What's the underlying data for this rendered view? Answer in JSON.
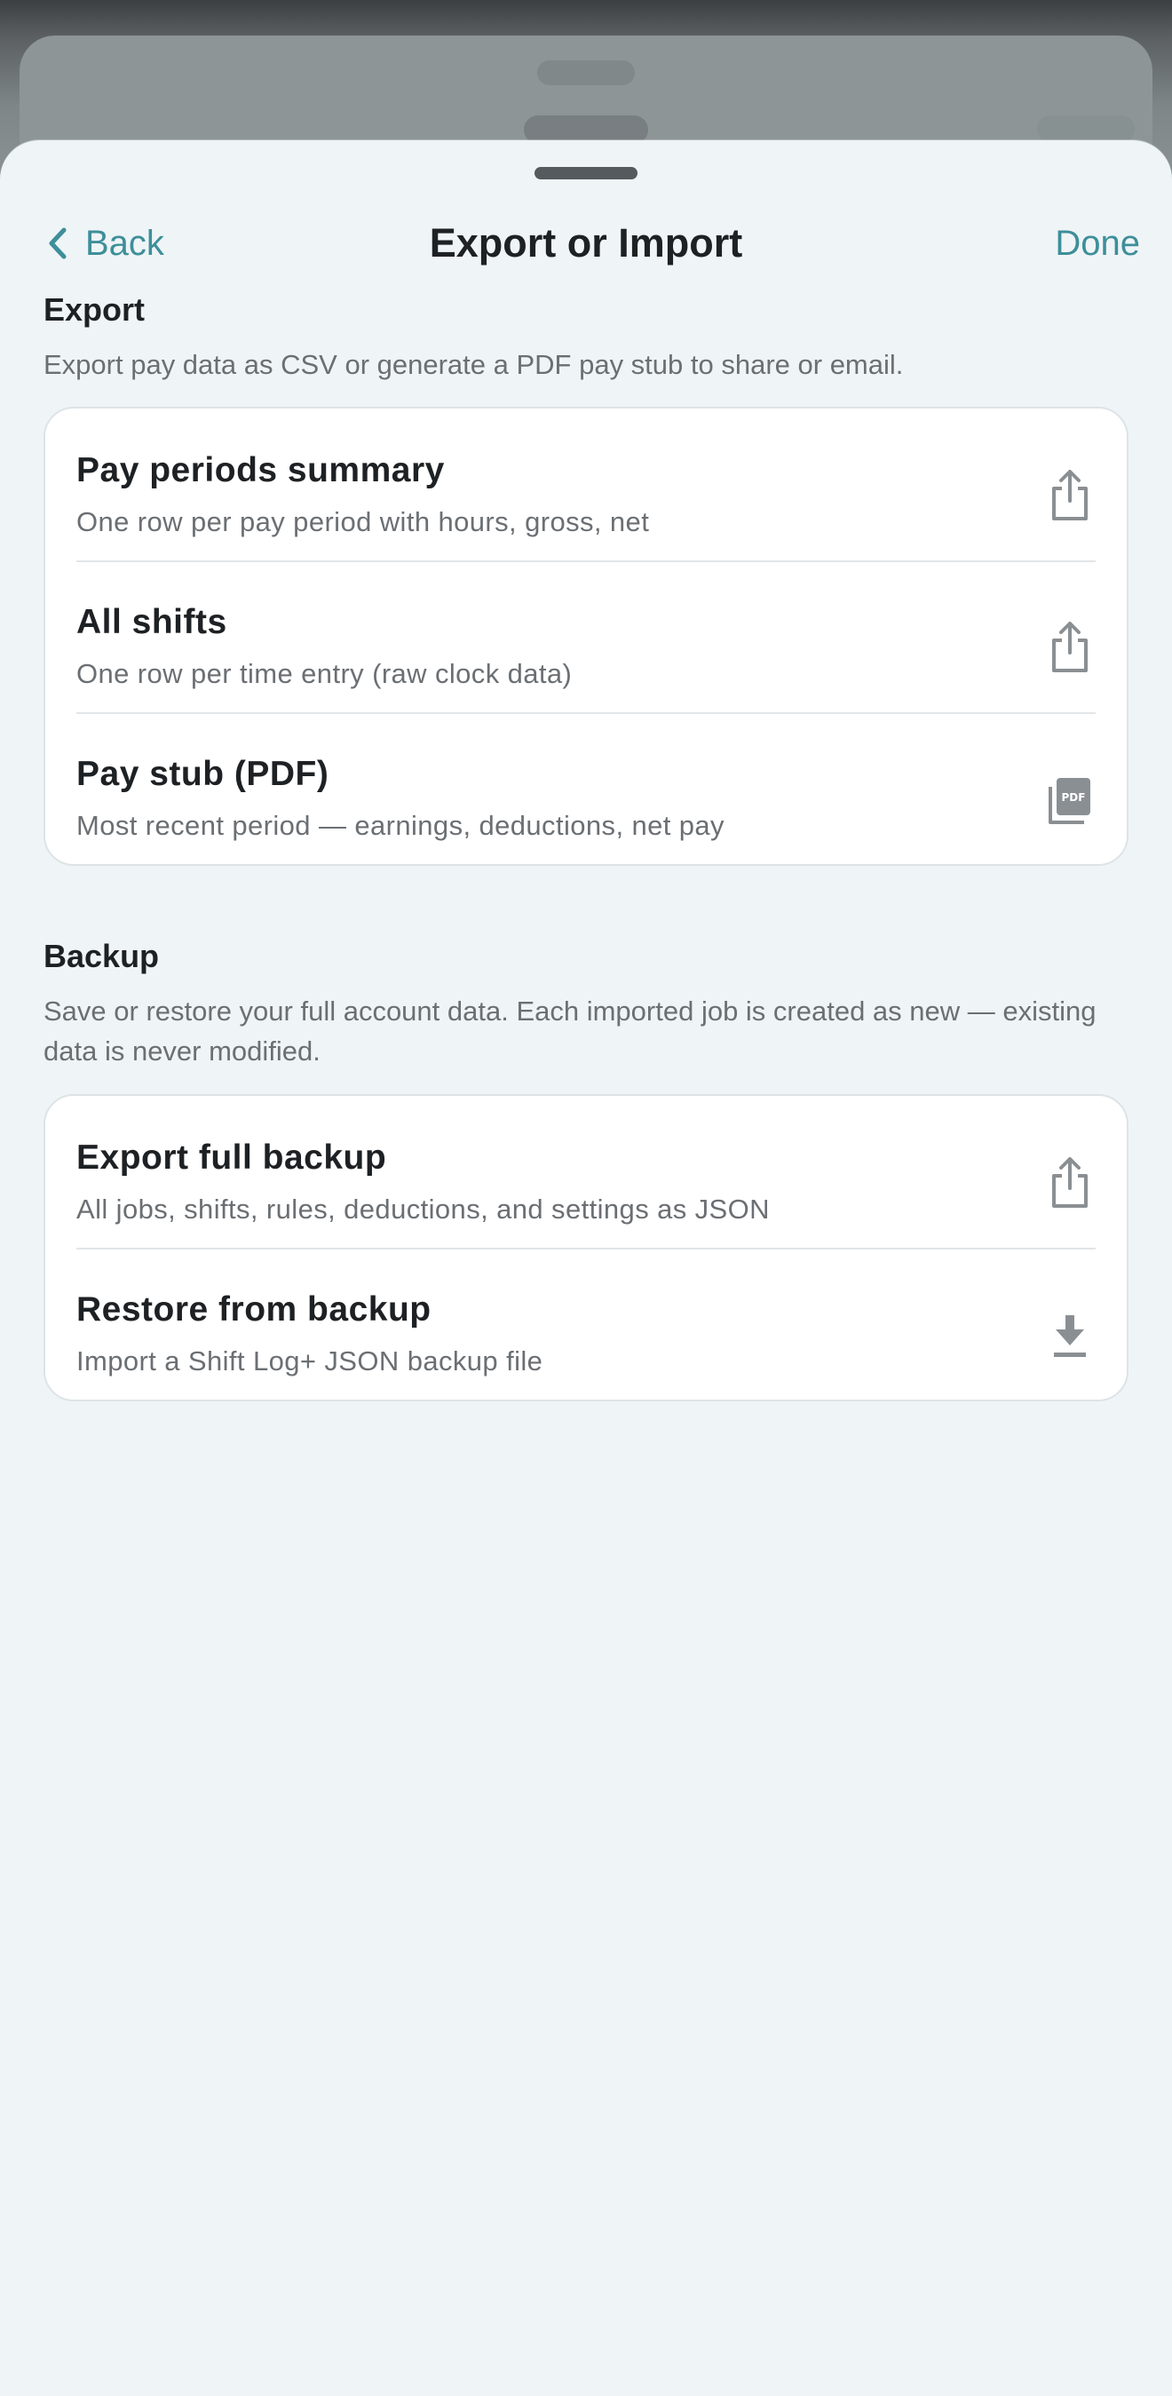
{
  "header": {
    "back_label": "Back",
    "title": "Export or Import",
    "done_label": "Done"
  },
  "export": {
    "title": "Export",
    "description": "Export pay data as CSV or generate a PDF pay stub to share or email.",
    "items": [
      {
        "title": "Pay periods summary",
        "subtitle": "One row per pay period with hours, gross, net",
        "icon": "share-icon"
      },
      {
        "title": "All shifts",
        "subtitle": "One row per time entry (raw clock data)",
        "icon": "share-icon"
      },
      {
        "title": "Pay stub (PDF)",
        "subtitle": "Most recent period — earnings, deductions, net pay",
        "icon": "pdf-icon"
      }
    ]
  },
  "backup": {
    "title": "Backup",
    "description": "Save or restore your full account data. Each imported job is created as new — existing data is never modified.",
    "items": [
      {
        "title": "Export full backup",
        "subtitle": "All jobs, shifts, rules, deductions, and settings as JSON",
        "icon": "share-icon"
      },
      {
        "title": "Restore from backup",
        "subtitle": "Import a Shift Log+ JSON backup file",
        "icon": "download-icon"
      }
    ]
  },
  "colors": {
    "accent": "#3d8f99",
    "sheet_background": "#eff4f7",
    "icon": "#8a8f93"
  }
}
